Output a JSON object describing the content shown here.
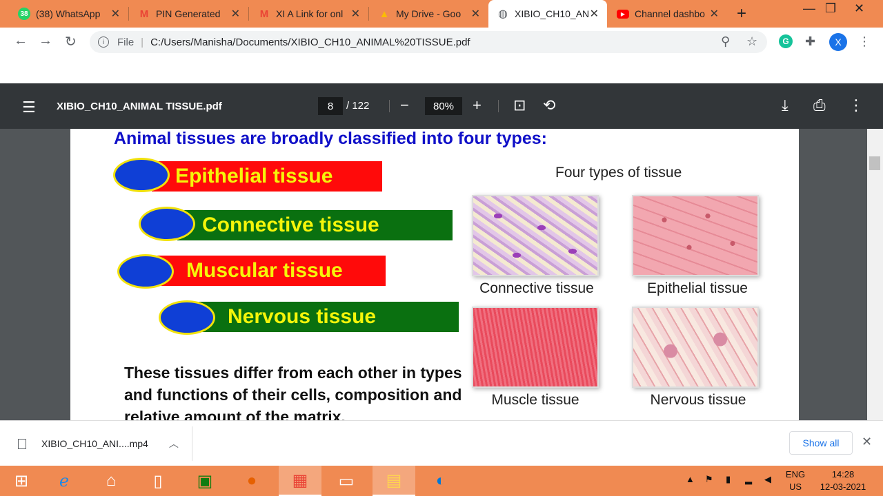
{
  "browser": {
    "tabs": [
      {
        "title": "(38) WhatsApp",
        "favicon": "whatsapp-icon",
        "badge": "38",
        "color": "#25d366"
      },
      {
        "title": "PIN Generated",
        "favicon": "gmail-icon",
        "color": "#ea4335"
      },
      {
        "title": "XI A Link for onl",
        "favicon": "gmail-icon",
        "color": "#ea4335"
      },
      {
        "title": "My Drive - Goo",
        "favicon": "drive-icon",
        "color": "#fbbc04"
      },
      {
        "title": "XIBIO_CH10_AN",
        "favicon": "globe-icon",
        "color": "#5f6368"
      },
      {
        "title": "Channel dashbo",
        "favicon": "youtube-icon",
        "color": "#ff0000"
      }
    ],
    "address": {
      "scheme_label": "File",
      "url": "C:/Users/Manisha/Documents/XIBIO_CH10_ANIMAL%20TISSUE.pdf"
    },
    "profile_initial": "X",
    "grammarly_initial": "G"
  },
  "pdf": {
    "filename": "XIBIO_CH10_ANIMAL TISSUE.pdf",
    "current_page": "8",
    "total_pages": "/ 122",
    "zoom": "80%"
  },
  "slide": {
    "heading": "Animal tissues are broadly classified into four types:",
    "bands": [
      {
        "label": "Epithelial tissue",
        "color": "#ff0a0a"
      },
      {
        "label": "Connective tissue",
        "color": "#0a7010"
      },
      {
        "label": "Muscular tissue",
        "color": "#ff0a0a"
      },
      {
        "label": "Nervous tissue",
        "color": "#0a7010"
      }
    ],
    "paragraph": "These tissues differ from each other in types and functions of their cells, composition and relative amount of the matrix.",
    "figure_title": "Four types of tissue",
    "figure_captions": [
      "Connective tissue",
      "Epithelial tissue",
      "Muscle tissue",
      "Nervous tissue"
    ]
  },
  "downloads": {
    "item": "XIBIO_CH10_ANI....mp4",
    "show_all": "Show all"
  },
  "taskbar": {
    "lang_top": "ENG",
    "lang_bottom": "US",
    "time": "14:28",
    "date": "12-03-2021"
  }
}
